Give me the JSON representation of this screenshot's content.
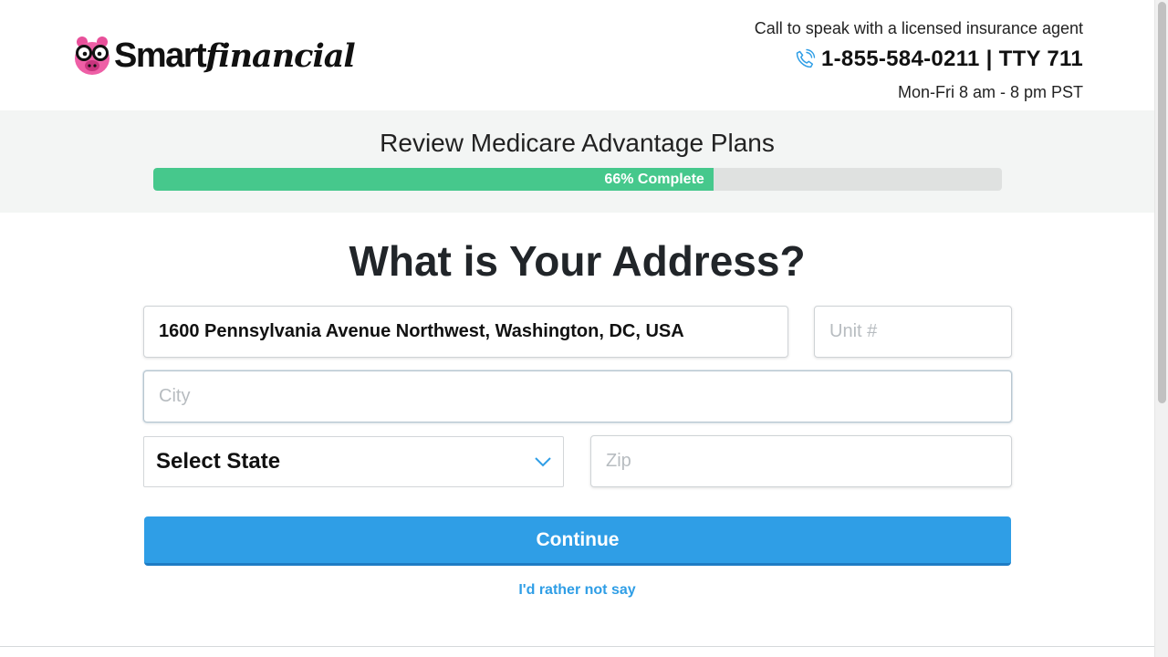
{
  "header": {
    "logo": {
      "smart": "Smart",
      "financial": "financial"
    },
    "contact": {
      "line1": "Call to speak with a licensed insurance agent",
      "phone": "1-855-584-0211 | TTY 711",
      "hours": "Mon-Fri 8 am - 8 pm PST"
    }
  },
  "progress": {
    "title": "Review Medicare Advantage Plans",
    "percent": 66,
    "label": "66% Complete"
  },
  "form": {
    "title": "What is Your Address?",
    "address": {
      "value": "1600 Pennsylvania Avenue Northwest, Washington, DC, USA",
      "placeholder": ""
    },
    "unit": {
      "value": "",
      "placeholder": "Unit #"
    },
    "city": {
      "value": "",
      "placeholder": "City"
    },
    "state": {
      "selected": "Select State"
    },
    "zip": {
      "value": "",
      "placeholder": "Zip"
    },
    "continue_label": "Continue",
    "skip_label": "I'd rather not say"
  },
  "colors": {
    "accent": "#2f9ee6",
    "progress_fill": "#46c88c",
    "progress_track": "#dfe1e0",
    "band_bg": "#f3f5f4",
    "logo_pig": "#e8509a"
  },
  "icons": [
    "pig-logo-icon",
    "phone-icon",
    "chevron-down-icon"
  ]
}
